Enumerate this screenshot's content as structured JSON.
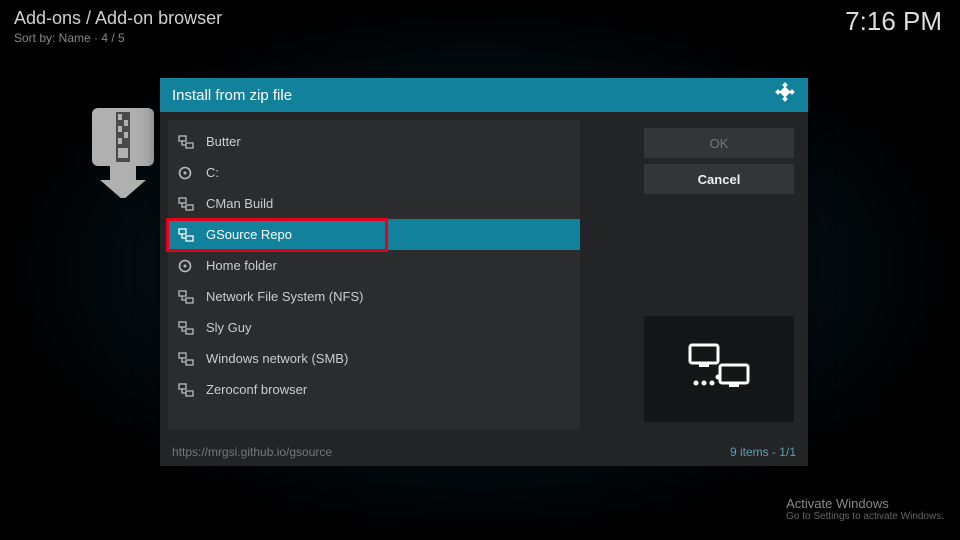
{
  "header": {
    "title": "Add-ons / Add-on browser",
    "sub": "Sort by: Name  ·  4 / 5"
  },
  "clock": "7:16 PM",
  "dialog": {
    "title": "Install from zip file",
    "items": [
      {
        "label": "Butter",
        "icon": "network"
      },
      {
        "label": "C:",
        "icon": "disk"
      },
      {
        "label": "CMan Build",
        "icon": "network"
      },
      {
        "label": "GSource Repo",
        "icon": "network",
        "selected": true
      },
      {
        "label": "Home folder",
        "icon": "disk"
      },
      {
        "label": "Network File System (NFS)",
        "icon": "network"
      },
      {
        "label": "Sly Guy",
        "icon": "network"
      },
      {
        "label": "Windows network (SMB)",
        "icon": "network"
      },
      {
        "label": "Zeroconf browser",
        "icon": "network"
      }
    ],
    "ok": "OK",
    "cancel": "Cancel",
    "footer_path": "https://mrgsi.github.io/gsource",
    "footer_count": "9 items - 1/1"
  },
  "watermark": {
    "line1": "Activate Windows",
    "line2": "Go to Settings to activate Windows."
  },
  "colors": {
    "accent": "#11819c",
    "highlight": "#e2001a"
  }
}
